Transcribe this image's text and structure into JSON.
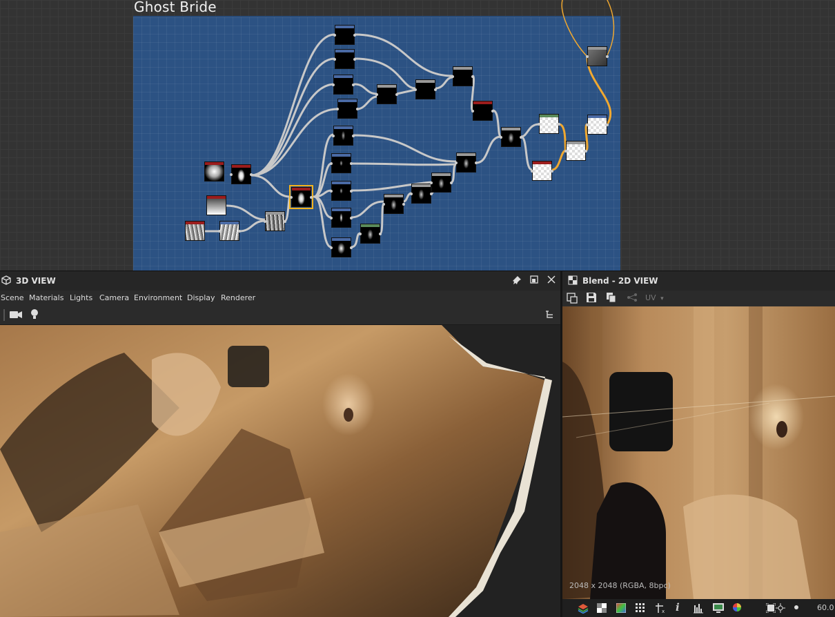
{
  "graph": {
    "frame_title": "Ghost Bride"
  },
  "panel3d": {
    "title": "3D VIEW",
    "menu": [
      "Scene",
      "Materials",
      "Lights",
      "Camera",
      "Environment",
      "Display",
      "Renderer"
    ],
    "icons": [
      "cube-icon",
      "pin-icon",
      "maximize-icon",
      "close-icon",
      "camera-icon",
      "light-bulb-icon",
      "tree-icon"
    ]
  },
  "panel2d": {
    "title": "Blend - 2D VIEW",
    "uv_label": "UV",
    "resolution": "2048 x 2048 (RGBA, 8bpc)",
    "zoom": "60.0",
    "icons": [
      "checker-icon",
      "export-icon",
      "save-icon",
      "copy-icon",
      "share-icon",
      "layers-icon",
      "alpha-icon",
      "color-icon",
      "grid-icon",
      "tile-icon",
      "info-icon",
      "histogram-icon",
      "display-icon",
      "color-wheel-icon",
      "fit-icon",
      "center-icon"
    ]
  },
  "colors": {
    "frame_bg": "#2c5283",
    "selection": "#f2b21c",
    "wire": "#c8c8c8",
    "wire_color_link": "#f0a830",
    "panel_bg": "#262626"
  }
}
